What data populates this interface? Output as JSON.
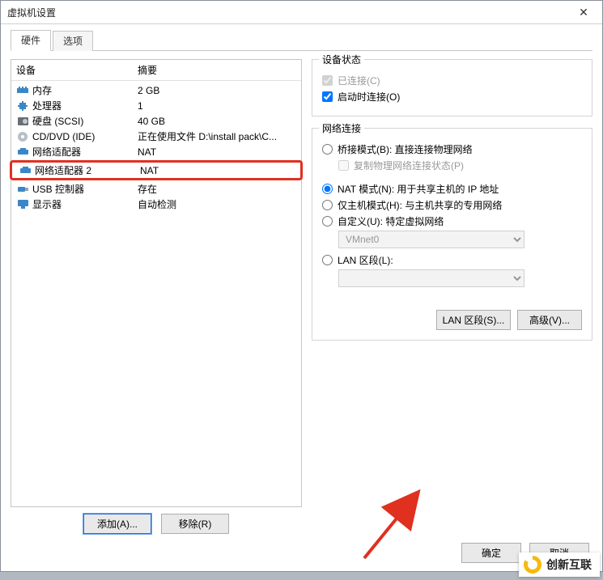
{
  "window": {
    "title": "虚拟机设置"
  },
  "tabs": {
    "hardware": "硬件",
    "options": "选项"
  },
  "columns": {
    "device": "设备",
    "summary": "摘要"
  },
  "devices": [
    {
      "name": "内存",
      "summary": "2 GB"
    },
    {
      "name": "处理器",
      "summary": "1"
    },
    {
      "name": "硬盘 (SCSI)",
      "summary": "40 GB"
    },
    {
      "name": "CD/DVD (IDE)",
      "summary": "正在使用文件 D:\\install pack\\C..."
    },
    {
      "name": "网络适配器",
      "summary": "NAT"
    },
    {
      "name": "网络适配器 2",
      "summary": "NAT"
    },
    {
      "name": "USB 控制器",
      "summary": "存在"
    },
    {
      "name": "显示器",
      "summary": "自动检测"
    }
  ],
  "left_buttons": {
    "add": "添加(A)...",
    "remove": "移除(R)"
  },
  "status_group": {
    "legend": "设备状态",
    "connected": "已连接(C)",
    "connect_on_start": "启动时连接(O)"
  },
  "net_group": {
    "legend": "网络连接",
    "bridged": "桥接模式(B): 直接连接物理网络",
    "replicate": "复制物理网络连接状态(P)",
    "nat": "NAT 模式(N): 用于共享主机的 IP 地址",
    "hostonly": "仅主机模式(H): 与主机共享的专用网络",
    "custom": "自定义(U): 特定虚拟网络",
    "custom_value": "VMnet0",
    "lan": "LAN 区段(L):",
    "lan_value": ""
  },
  "right_buttons": {
    "lan_segments": "LAN 区段(S)...",
    "advanced": "高级(V)..."
  },
  "footer": {
    "ok": "确定",
    "cancel": "取消"
  },
  "logo": {
    "text": "创新互联"
  }
}
